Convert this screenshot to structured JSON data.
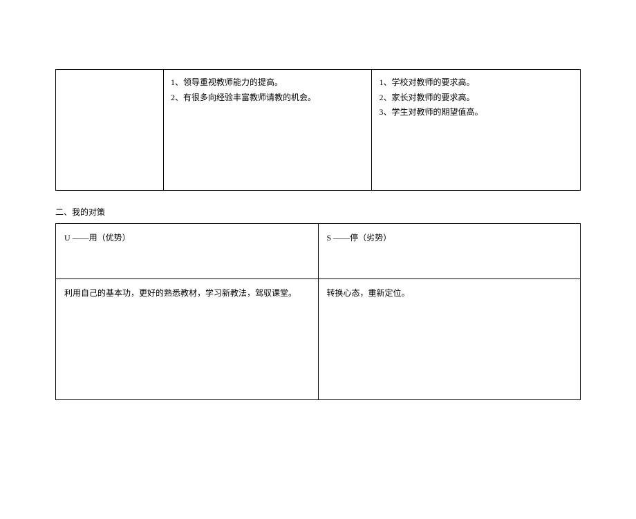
{
  "table1": {
    "col2_items": [
      "1、领导重视教师能力的提高。",
      "2、有很多向经验丰富教师请教的机会。"
    ],
    "col3_items": [
      "1、学校对教师的要求高。",
      "2、家长对教师的要求高。",
      "3、学生对教师的期望值高。"
    ]
  },
  "section2": {
    "title": "二、我的对策",
    "headers": {
      "left": "U ——用（优势）",
      "right": "S ——停（劣势）"
    },
    "content": {
      "left": "利用自己的基本功，更好的熟悉教材，学习新教法，驾驭课堂。",
      "right": "转换心态，重新定位。"
    }
  }
}
